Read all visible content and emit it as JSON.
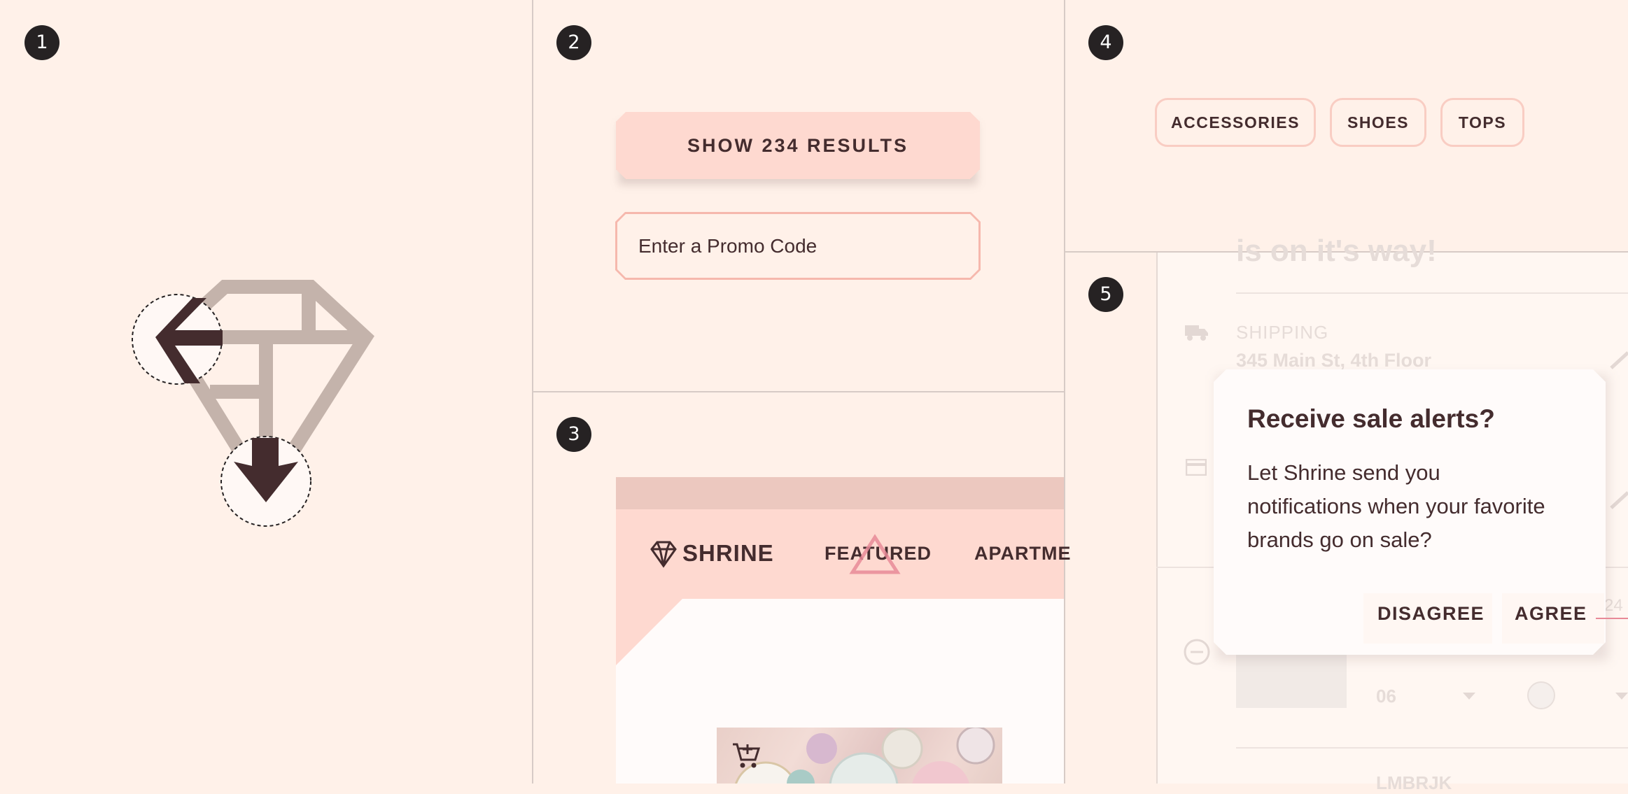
{
  "panel_numbers": [
    "1",
    "2",
    "3",
    "4",
    "5"
  ],
  "panel2": {
    "show_results_label": "SHOW 234 RESULTS",
    "promo_placeholder": "Enter a Promo Code"
  },
  "panel3": {
    "brand": "SHRINE",
    "nav": [
      "FEATURED",
      "APARTME"
    ]
  },
  "panel4": {
    "chips": [
      "ACCESSORIES",
      "SHOES",
      "TOPS"
    ]
  },
  "panel5": {
    "background": {
      "heading_fragment": "is on it's way!",
      "shipping_label": "SHIPPING",
      "shipping_address": "345 Main St, 4th Floor",
      "size_value": "06",
      "partial_number": "24",
      "partial_code": "LMBRJK"
    },
    "dialog": {
      "title": "Receive sale alerts?",
      "body": "Let Shrine send you notifications when your favorite brands go on sale?",
      "disagree_label": "DISAGREE",
      "agree_label": "AGREE"
    }
  },
  "colors": {
    "background": "#fff1e9",
    "primary": "#fed9d0",
    "outline": "#f6b8ad",
    "text": "#442c2e",
    "accent_pink": "#e88a98"
  }
}
